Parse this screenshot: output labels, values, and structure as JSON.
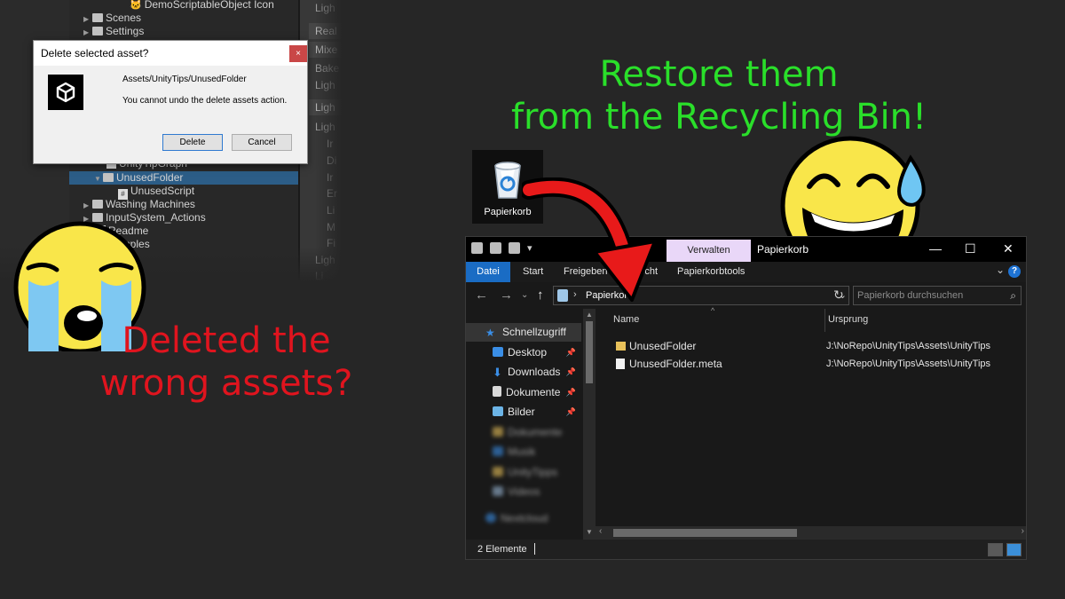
{
  "unity": {
    "tree": [
      {
        "label": "DemoScriptableObject Icon",
        "kind": "emoji"
      },
      {
        "label": "Scenes",
        "kind": "folder"
      },
      {
        "label": "Settings",
        "kind": "folder"
      },
      {
        "label": "UnityTipGraph",
        "kind": "asset"
      },
      {
        "label": "UnusedFolder",
        "kind": "folder-open",
        "selected": true
      },
      {
        "label": "UnusedScript",
        "kind": "script"
      },
      {
        "label": "Washing Machines",
        "kind": "folder"
      },
      {
        "label": "InputSystem_Actions",
        "kind": "folder"
      },
      {
        "label": "Readme",
        "kind": "asset"
      },
      {
        "label": "Samples",
        "kind": "asset"
      }
    ],
    "inspector_rows": [
      "Ligh",
      "Real",
      "Mixe",
      "Bake",
      "Ligh",
      "Ligh",
      "Ligh",
      "Ir",
      "Di",
      "Ir",
      "Er",
      "Li",
      "M",
      "Fi",
      "Ligh",
      "Li"
    ]
  },
  "dialog": {
    "title": "Delete selected asset?",
    "close_label": "×",
    "path": "Assets/UnityTips/UnusedFolder",
    "message": "You cannot undo the delete assets action.",
    "delete_label": "Delete",
    "cancel_label": "Cancel"
  },
  "captions": {
    "restore_line1": "Restore them",
    "restore_line2": "from the Recycling Bin!",
    "deleted_line1": "Deleted the",
    "deleted_line2": "wrong assets?",
    "restore_color": "#2adf2a",
    "deleted_color": "#e0141e"
  },
  "desktop": {
    "recycle_label": "Papierkorb",
    "icon": "recycle-bin-icon"
  },
  "explorer": {
    "context_tab": "Verwalten",
    "window_title": "Papierkorb",
    "window_controls": {
      "minimize": "—",
      "maximize": "☐",
      "close": "✕"
    },
    "ribbon_tabs": [
      "Datei",
      "Start",
      "Freigeben",
      "Ansicht",
      "Papierkorbtools"
    ],
    "help_label": "?",
    "address_text": "Papierkorb",
    "search_placeholder": "Papierkorb durchsuchen",
    "nav_items": [
      {
        "label": "Schnellzugriff",
        "icon": "star-icon",
        "color": "#3a8ee6"
      },
      {
        "label": "Desktop",
        "icon": "desktop-icon",
        "color": "#3a8ee6",
        "pinned": true
      },
      {
        "label": "Downloads",
        "icon": "download-icon",
        "color": "#3a8ee6",
        "pinned": true
      },
      {
        "label": "Dokumente",
        "icon": "document-icon",
        "color": "#d9d9d9",
        "pinned": true
      },
      {
        "label": "Bilder",
        "icon": "pictures-icon",
        "color": "#6cb4e6",
        "pinned": true
      },
      {
        "label": "Dokumente",
        "icon": "folder-icon",
        "color": "#e8c15a",
        "blurred": true
      },
      {
        "label": "Musik",
        "icon": "music-icon",
        "color": "#3a8ee6",
        "blurred": true
      },
      {
        "label": "UnityTipps",
        "icon": "folder-icon",
        "color": "#e8c15a",
        "blurred": true
      },
      {
        "label": "Videos",
        "icon": "video-icon",
        "color": "#9ab8d6",
        "blurred": true
      },
      {
        "label": "Nextcloud",
        "icon": "cloud-icon",
        "color": "#3a8ee6",
        "blurred": true
      }
    ],
    "columns": {
      "name": "Name",
      "origin": "Ursprung"
    },
    "files": [
      {
        "name": "UnusedFolder",
        "origin": "J:\\NoRepo\\UnityTips\\Assets\\UnityTips",
        "icon": "folder-icon",
        "color": "#e8c15a"
      },
      {
        "name": "UnusedFolder.meta",
        "origin": "J:\\NoRepo\\UnityTips\\Assets\\UnityTips",
        "icon": "file-icon",
        "color": "#f2f2f2"
      }
    ],
    "status_text": "2 Elemente"
  }
}
